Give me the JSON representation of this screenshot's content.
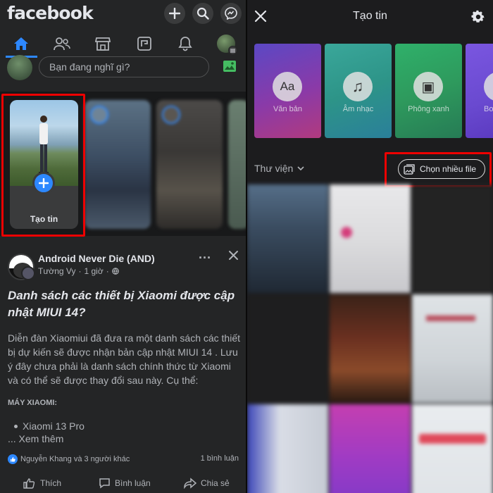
{
  "left": {
    "logo": "facebook",
    "composer_placeholder": "Bạn đang nghĩ gì?",
    "story_create_label": "Tạo tin",
    "post": {
      "group": "Android Never Die (AND)",
      "author": "Tường Vy",
      "time": "1 giờ",
      "title": "Danh sách các thiết bị Xiaomi được cập nhật MIUI 14?",
      "body": "Diễn đàn Xiaomiui đã đưa ra một danh sách các thiết bị dự kiến sẽ được nhận bản cập nhật MIUI 14 . Lưu ý đây chưa phải là danh sách chính thức từ Xiaomi và có thể sẽ được thay đổi sau này. Cụ thể:",
      "section": "MÁY XIAOMI:",
      "bullet": "Xiaomi 13 Pro",
      "see_more": "... Xem thêm",
      "reactions": "Nguyễn Khang và 3 người khác",
      "comments": "1 bình luận",
      "like": "Thích",
      "comment": "Bình luận",
      "share": "Chia sẻ"
    }
  },
  "right": {
    "title": "Tạo tin",
    "cards": [
      {
        "label": "Văn bản",
        "icon": "text-aa-icon",
        "glyph": "Aa"
      },
      {
        "label": "Âm nhạc",
        "icon": "music-note-icon",
        "glyph": "♫"
      },
      {
        "label": "Phông xanh",
        "icon": "green-screen-icon",
        "glyph": "▣"
      },
      {
        "label": "Boo",
        "icon": "boomerang-icon",
        "glyph": "∞"
      }
    ],
    "library_label": "Thư viện",
    "multi_select_label": "Chọn nhiều file"
  },
  "colors": {
    "accent": "#2d88ff",
    "highlight": "#ee0000",
    "card_text": "#7b3fb5",
    "card_music": "#2f9a8c",
    "card_green": "#2e9a5d",
    "card_boomerang": "#6a4ad0"
  }
}
